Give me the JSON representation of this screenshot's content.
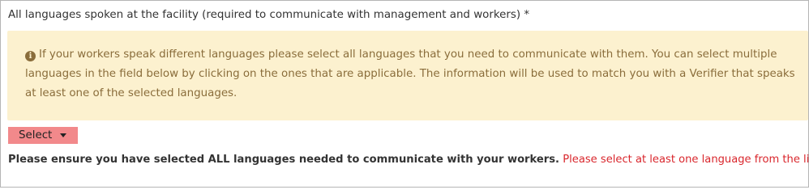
{
  "field": {
    "label": "All languages spoken at the facility (required to communicate with management and workers) *"
  },
  "info": {
    "icon": "info-circle-icon",
    "text": "If your workers speak different languages please select all languages that you need to communicate with them. You can select multiple languages in the field below by clicking on the ones that are applicable. The information will be used to match you with a Verifier that speaks at least one of the selected languages."
  },
  "select": {
    "label": "Select",
    "icon": "caret-down-icon",
    "color": "#f2898b"
  },
  "validation": {
    "instruction": "Please ensure you have selected ALL languages needed to communicate with your workers.",
    "error": "Please select at least one language from the list!",
    "error_color": "#d9262c"
  },
  "colors": {
    "info_background": "#fcf1cf",
    "info_text": "#8a6d3b"
  }
}
